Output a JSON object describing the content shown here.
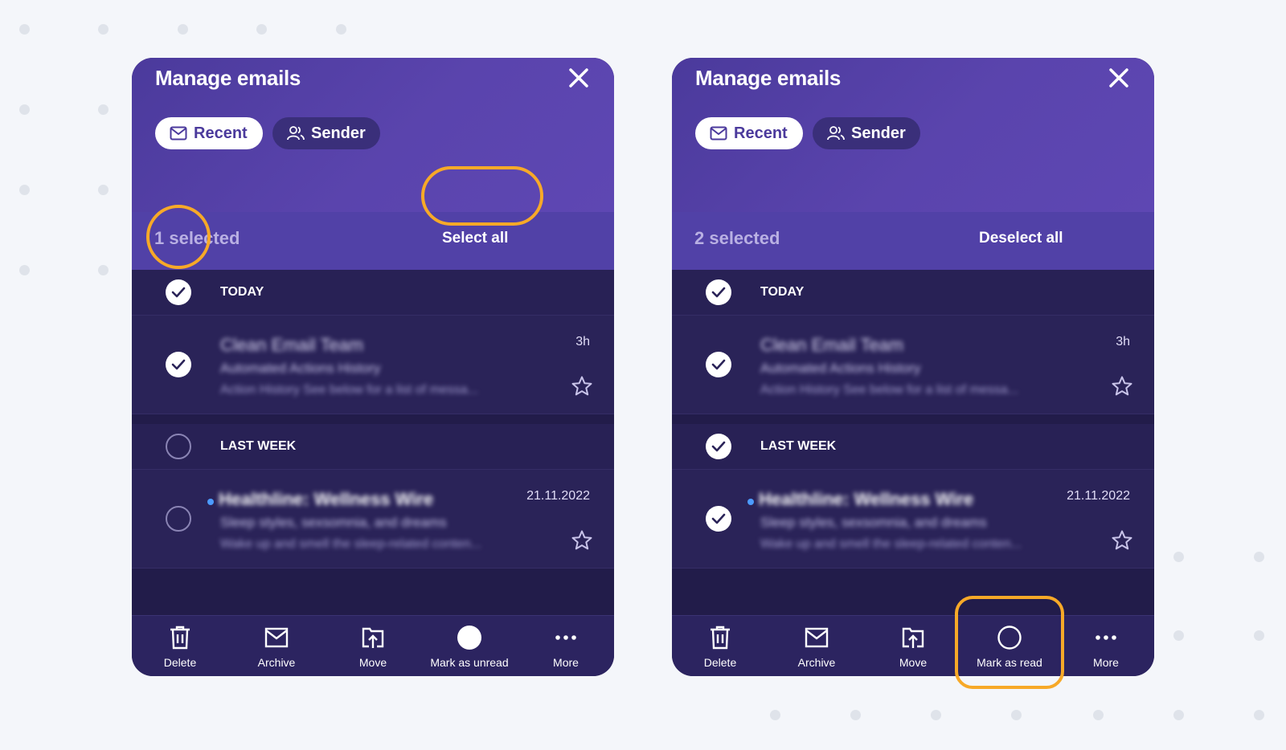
{
  "panels": [
    {
      "title": "Manage emails",
      "tabs": [
        {
          "label": "Recent",
          "icon": "envelope-icon"
        },
        {
          "label": "Sender",
          "icon": "users-icon"
        }
      ],
      "selected_count": "1 selected",
      "select_action": "Select all",
      "groups": [
        {
          "label": "TODAY",
          "checked": true,
          "email": {
            "sender": "Clean Email Team",
            "subject": "Automated Actions History",
            "preview": "Action History See below for a list of messa...",
            "time": "3h",
            "checked": true,
            "unread": false
          }
        },
        {
          "label": "LAST WEEK",
          "checked": false,
          "email": {
            "sender": "Healthline: Wellness Wire",
            "subject": "Sleep styles, sexsomnia, and dreams",
            "preview": "Wake up and smell the sleep-related conten...",
            "time": "21.11.2022",
            "checked": false,
            "unread": true
          }
        }
      ],
      "toolbar": [
        {
          "label": "Delete",
          "icon": "trash-icon"
        },
        {
          "label": "Archive",
          "icon": "archive-icon"
        },
        {
          "label": "Move",
          "icon": "move-icon"
        },
        {
          "label": "Mark as unread",
          "icon": "filled-circle-icon"
        },
        {
          "label": "More",
          "icon": "more-dots-icon"
        }
      ]
    },
    {
      "title": "Manage emails",
      "tabs": [
        {
          "label": "Recent",
          "icon": "envelope-icon"
        },
        {
          "label": "Sender",
          "icon": "users-icon"
        }
      ],
      "selected_count": "2 selected",
      "select_action": "Deselect all",
      "groups": [
        {
          "label": "TODAY",
          "checked": true,
          "email": {
            "sender": "Clean Email Team",
            "subject": "Automated Actions History",
            "preview": "Action History See below for a list of messa...",
            "time": "3h",
            "checked": true,
            "unread": false
          }
        },
        {
          "label": "LAST WEEK",
          "checked": true,
          "email": {
            "sender": "Healthline: Wellness Wire",
            "subject": "Sleep styles, sexsomnia, and dreams",
            "preview": "Wake up and smell the sleep-related conten...",
            "time": "21.11.2022",
            "checked": true,
            "unread": true
          }
        }
      ],
      "toolbar": [
        {
          "label": "Delete",
          "icon": "trash-icon"
        },
        {
          "label": "Archive",
          "icon": "archive-icon"
        },
        {
          "label": "Move",
          "icon": "move-icon"
        },
        {
          "label": "Mark as read",
          "icon": "outline-circle-icon"
        },
        {
          "label": "More",
          "icon": "more-dots-icon"
        }
      ]
    }
  ],
  "colors": {
    "header": "#5141a7",
    "panel_bg": "#221c4a",
    "highlight": "#f7a928",
    "unread_dot": "#4c9bff"
  }
}
